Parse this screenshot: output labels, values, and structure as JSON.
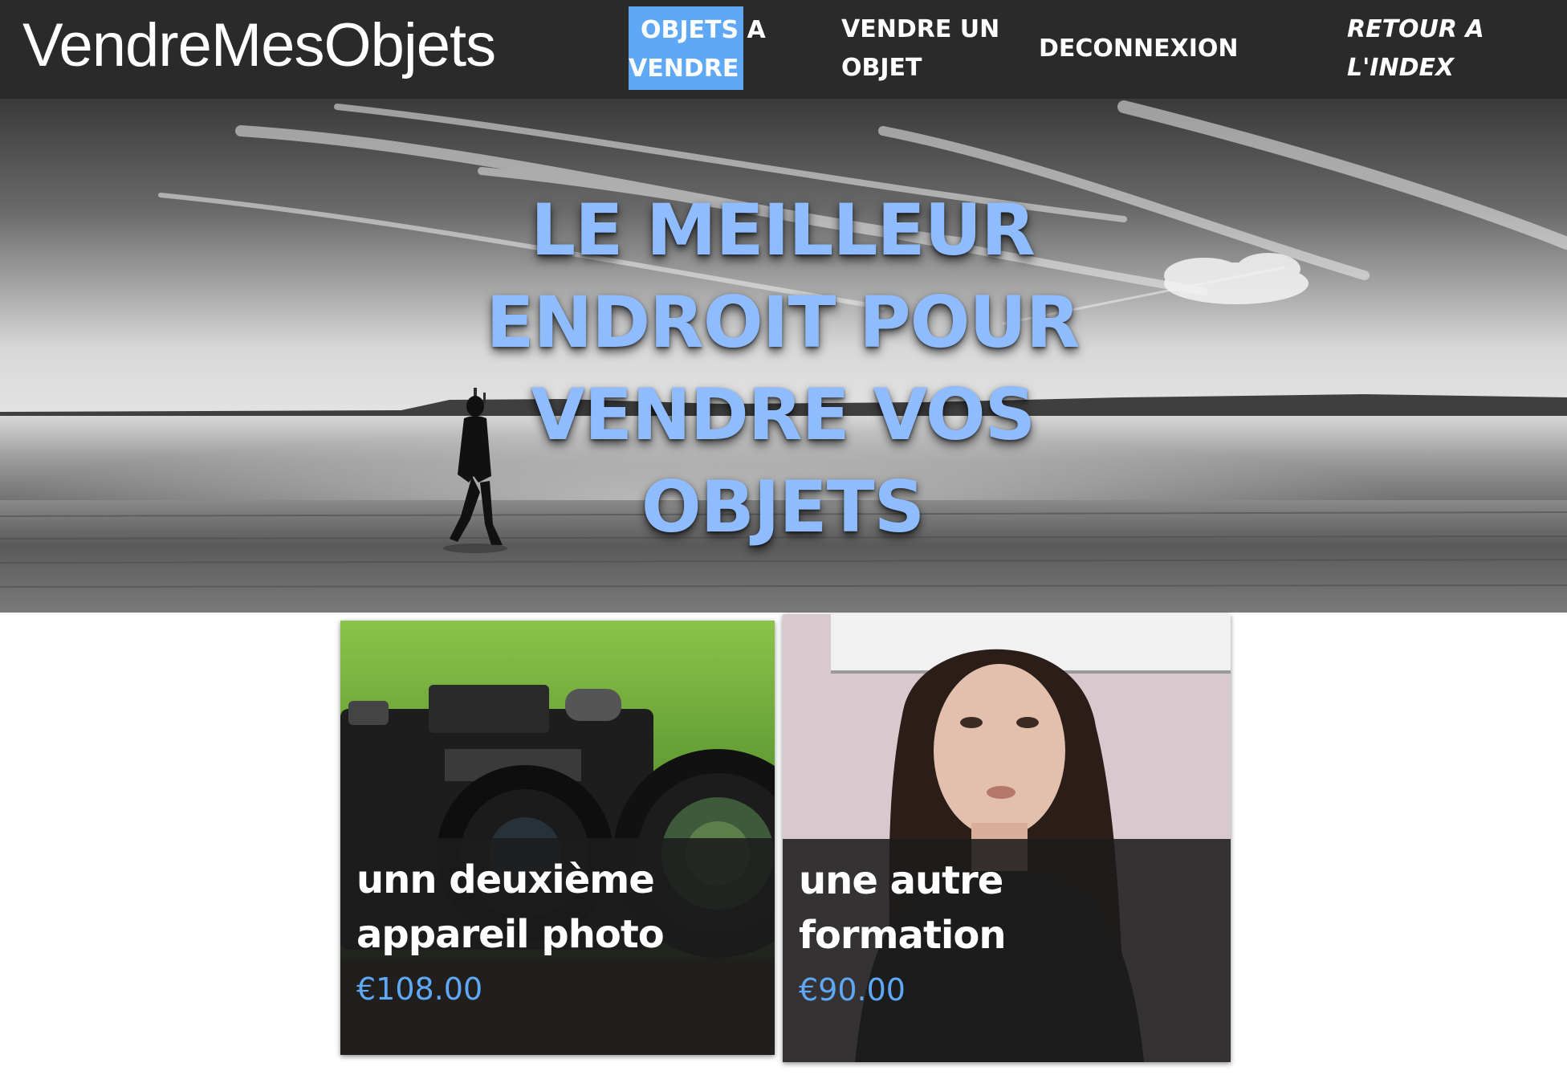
{
  "navbar": {
    "brand": "VendreMesObjets",
    "links": [
      {
        "label_line1": "OBJETS A",
        "label_line2": "VENDRE",
        "active": true
      },
      {
        "label_line1": "VENDRE UN",
        "label_line2": "OBJET",
        "active": false
      },
      {
        "label": "DECONNEXION",
        "active": false
      },
      {
        "label_line1": "RETOUR A",
        "label_line2": "L'INDEX",
        "active": false
      }
    ],
    "background_color": "#2a2a2a",
    "active_color": "#5fa8f6"
  },
  "hero": {
    "title_lines": [
      "LE MEILLEUR",
      "ENDROIT POUR",
      "VENDRE VOS",
      "OBJETS"
    ],
    "title_color": "#8fbcff",
    "image": "black-and-white beach with walking person"
  },
  "products": [
    {
      "title_line1": "unn deuxième",
      "title_line2": "appareil photo",
      "price": "€108.00",
      "image": "camera-photo"
    },
    {
      "title_line1": "une autre",
      "title_line2": "formation",
      "price": "€90.00",
      "image": "woman-portrait"
    }
  ],
  "colors": {
    "accent": "#5fa8f6",
    "card_overlay": "#1c1c1c"
  }
}
